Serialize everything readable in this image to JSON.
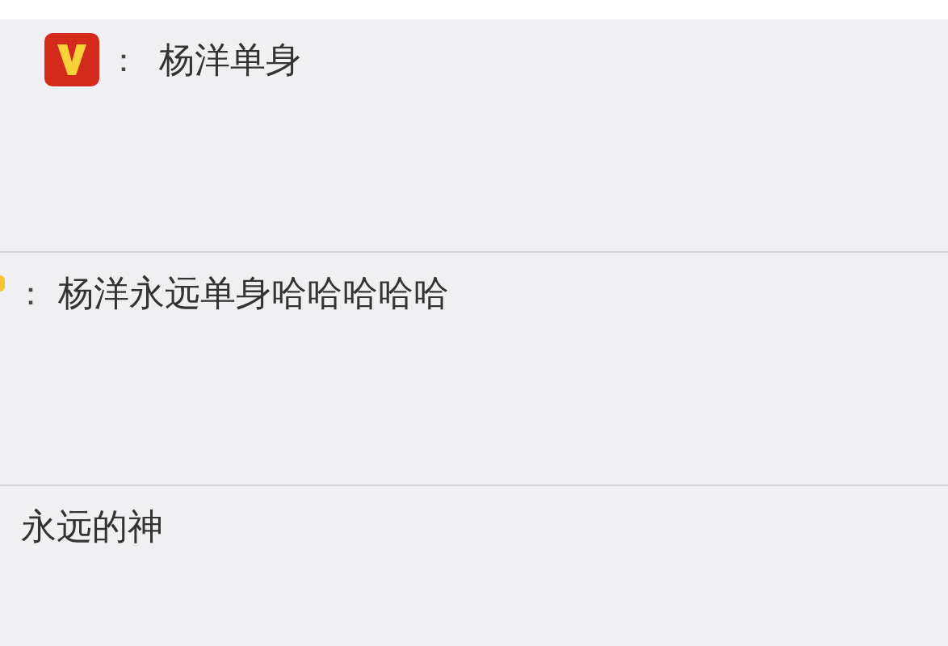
{
  "comments": [
    {
      "kind": "vip",
      "separator": "：",
      "text": "杨洋单身"
    },
    {
      "kind": "cut",
      "separator": "：",
      "text": "杨洋永远单身哈哈哈哈哈"
    },
    {
      "kind": "plain",
      "text": "永远的神"
    }
  ]
}
